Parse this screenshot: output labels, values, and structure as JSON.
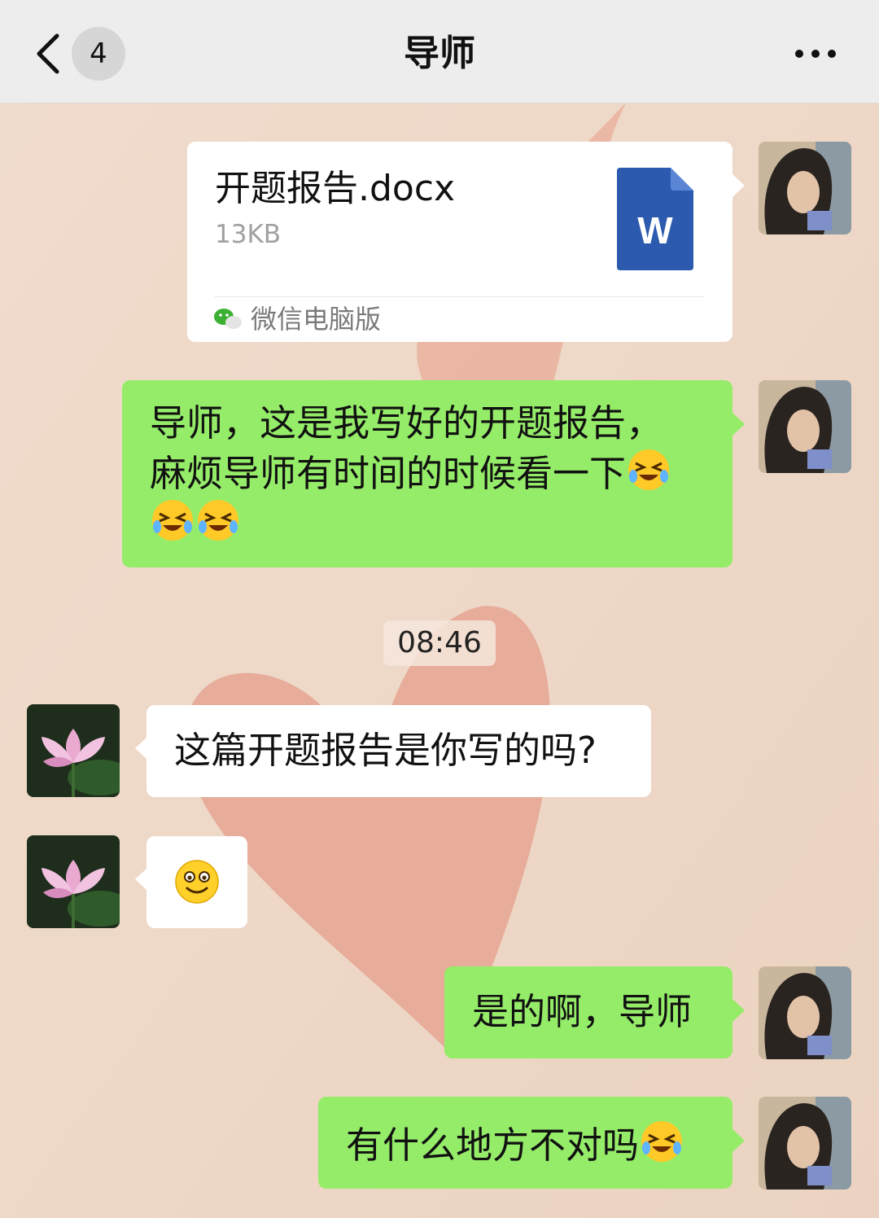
{
  "header": {
    "back_icon": "chevron-left-icon",
    "unread_count": "4",
    "title": "导师",
    "more_icon": "more-dots-icon"
  },
  "colors": {
    "header_bg": "#ededed",
    "sent_bubble": "#95ec69",
    "received_bubble": "#ffffff",
    "word_blue": "#2b5aaf"
  },
  "messages": [
    {
      "side": "right",
      "type": "file",
      "file_name": "开题报告.docx",
      "file_size": "13KB",
      "file_icon": "word-doc-icon",
      "file_icon_letter": "W",
      "source_icon": "wechat-icon",
      "source": "微信电脑版"
    },
    {
      "side": "right",
      "type": "text",
      "line1": "导师，这是我写好的开题报告，",
      "line2": "麻烦导师有时间的时候看一下",
      "emoji": "grinning-squint-tears-emoji"
    },
    {
      "type": "timestamp",
      "text": "08:46"
    },
    {
      "side": "left",
      "type": "text",
      "text": "这篇开题报告是你写的吗?"
    },
    {
      "side": "left",
      "type": "emoji",
      "emoji": "smile-emoji"
    },
    {
      "side": "right",
      "type": "text",
      "text": "是的啊，导师"
    },
    {
      "side": "right",
      "type": "text",
      "text": "有什么地方不对吗",
      "emoji": "grinning-squint-tears-emoji"
    }
  ]
}
